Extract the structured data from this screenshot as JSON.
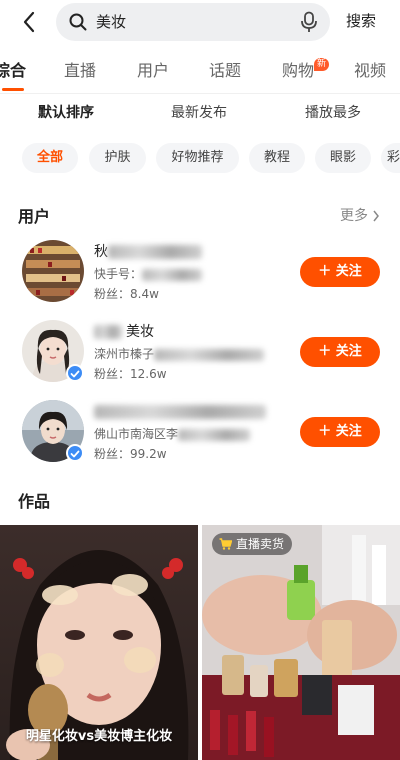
{
  "search": {
    "query": "美妆",
    "button_label": "搜索"
  },
  "tabs": [
    {
      "label": "综合",
      "active": true
    },
    {
      "label": "直播"
    },
    {
      "label": "用户"
    },
    {
      "label": "话题"
    },
    {
      "label": "购物",
      "badge": "新"
    },
    {
      "label": "视频"
    }
  ],
  "sort_options": [
    "默认排序",
    "最新发布",
    "播放最多"
  ],
  "filter_chips": [
    "全部",
    "护肤",
    "好物推荐",
    "教程",
    "眼影",
    "彩"
  ],
  "users_section": {
    "title": "用户",
    "more_label": "更多"
  },
  "users": [
    {
      "name_visible": "秋",
      "sub_visible": "快手号：",
      "fans": "粉丝：8.4w",
      "follow_label": "＋ 关注",
      "verified": false
    },
    {
      "name_visible": "美妆",
      "sub_visible": "滦州市榛子",
      "fans": "粉丝：12.6w",
      "follow_label": "＋ 关注",
      "verified": true
    },
    {
      "name_visible": "",
      "sub_visible": "佛山市南海区李",
      "fans": "粉丝：99.2w",
      "follow_label": "＋ 关注",
      "verified": true
    }
  ],
  "works_section": {
    "title": "作品"
  },
  "works": [
    {
      "caption": "明星化妆vs美妆博主化妆"
    },
    {
      "live_tag": "直播卖货"
    }
  ],
  "colors": {
    "accent": "#ff5000",
    "verified": "#3d8cf5"
  }
}
